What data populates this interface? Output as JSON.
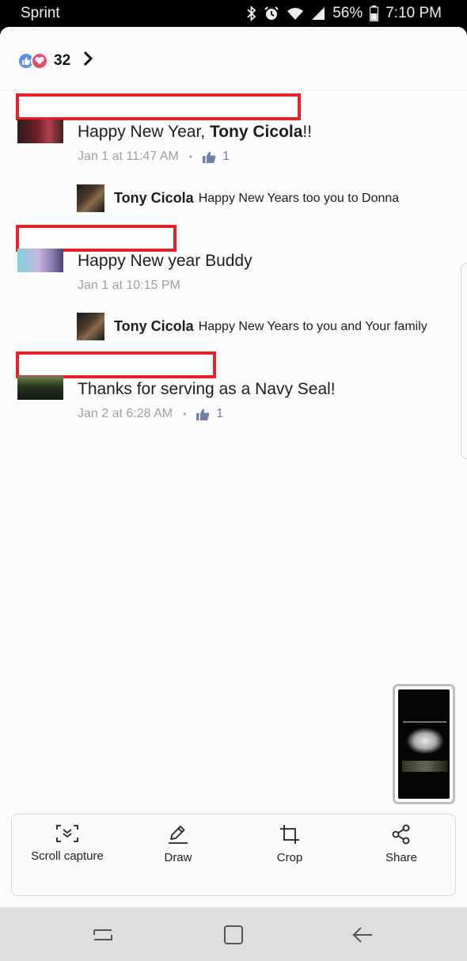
{
  "status_bar": {
    "carrier": "Sprint",
    "battery": "56%",
    "time": "7:10 PM"
  },
  "reactions": {
    "count": "32"
  },
  "comments": [
    {
      "text_prefix": "Happy New Year, ",
      "text_bold": "Tony Cicola",
      "text_suffix": "!!",
      "time": "Jan 1 at 11:47 AM",
      "likes": "1",
      "reply": {
        "name": "Tony Cicola",
        "text": "Happy New Years too you to Donna"
      }
    },
    {
      "text": "Happy New year Buddy",
      "time": "Jan 1 at 10:15 PM",
      "reply": {
        "name": "Tony Cicola",
        "text": "Happy New Years to you and Your family"
      }
    },
    {
      "text": "Thanks for serving as a Navy Seal!",
      "time": "Jan 2 at 6:28 AM",
      "likes": "1"
    }
  ],
  "toolbar": {
    "scroll_capture": "Scroll capture",
    "draw": "Draw",
    "crop": "Crop",
    "share": "Share"
  },
  "icons": {
    "like": "thumbs-up-icon",
    "love": "heart-icon",
    "chevron": "chevron-right-icon",
    "scroll_capture": "scroll-capture-icon",
    "draw": "pencil-icon",
    "crop": "crop-icon",
    "share": "share-icon",
    "recents": "recents-icon",
    "home": "home-icon",
    "back": "back-icon"
  },
  "colors": {
    "like_blue": "#5b8def",
    "love_red": "#ef4767",
    "redaction_red": "#e2232b",
    "meta_gray": "#9aa0a6"
  }
}
